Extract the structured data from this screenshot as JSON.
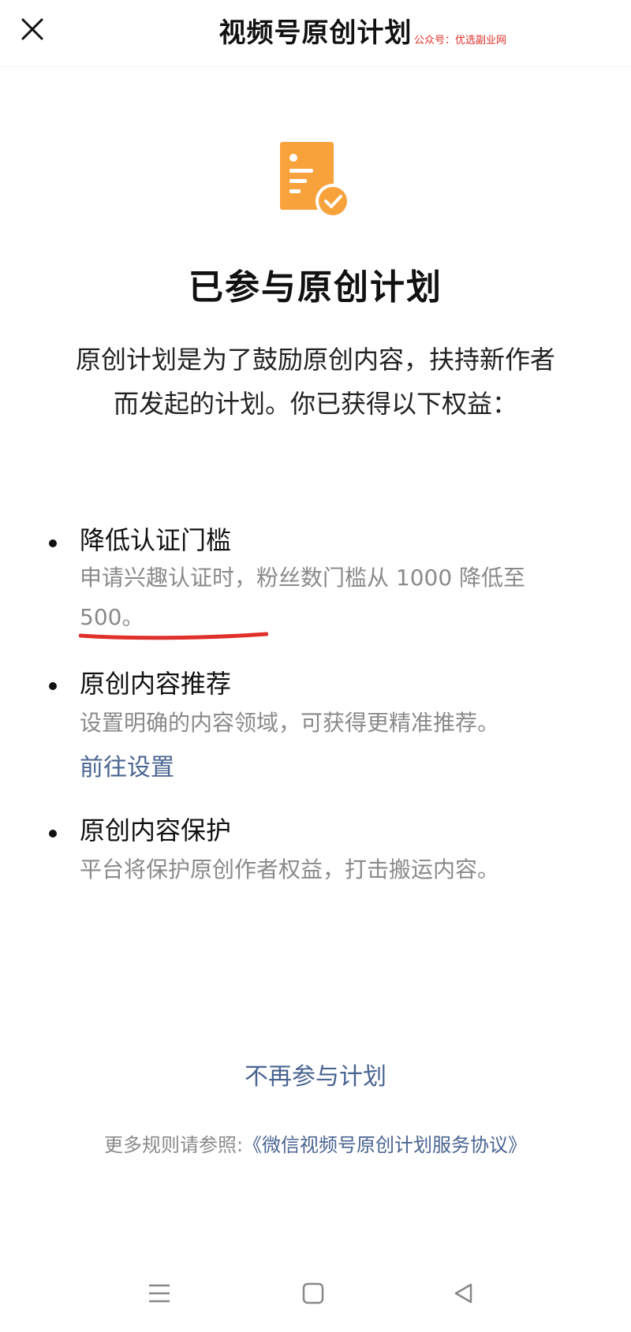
{
  "header": {
    "title": "视频号原创计划",
    "close_icon": "close-icon",
    "watermark": "公众号：优选副业网",
    "watermark_color": "#e0302b"
  },
  "hero": {
    "icon": "document-check-icon",
    "accent_color": "#f7a23b"
  },
  "status": {
    "title": "已参与原创计划",
    "intro_line1": "原创计划是为了鼓励原创内容，扶持新作者",
    "intro_line2": "而发起的计划。你已获得以下权益："
  },
  "benefits": [
    {
      "title": "降低认证门槛",
      "desc_line1": "申请兴趣认证时，粉丝数门槛从 1000 降低至",
      "desc_line2": "500。"
    },
    {
      "title": "原创内容推荐",
      "desc": "设置明确的内容领域，可获得更精准推荐。",
      "link": "前往设置"
    },
    {
      "title": "原创内容保护",
      "desc": "平台将保护原创作者权益，打击搬运内容。"
    }
  ],
  "actions": {
    "quit_label": "不再参与计划",
    "rules_prefix": "更多规则请参照:",
    "rules_link": "《微信视频号原创计划服务协议》",
    "link_color": "#4a6491"
  },
  "navbar": {
    "menu_icon": "menu-icon",
    "home_icon": "home-square-icon",
    "back_icon": "back-triangle-icon"
  }
}
